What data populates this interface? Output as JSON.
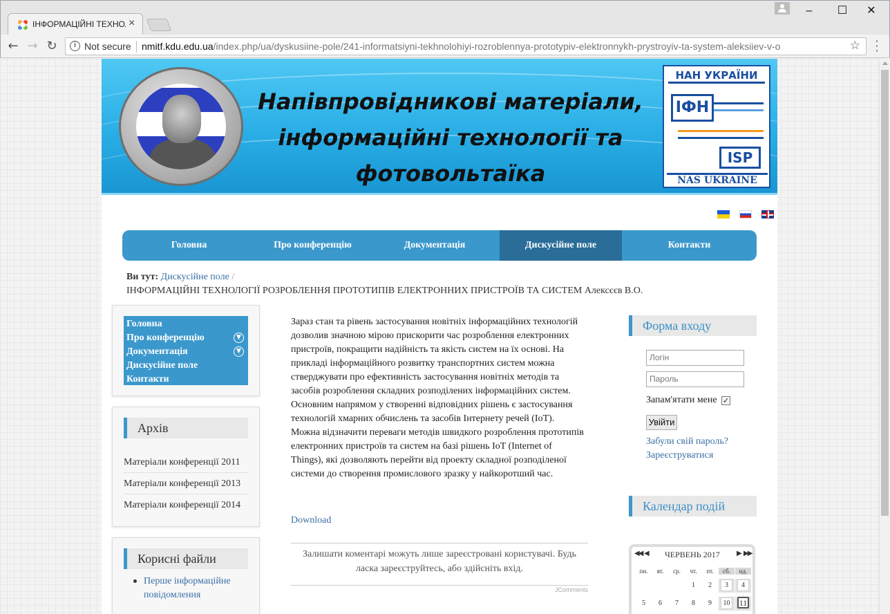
{
  "browser": {
    "tab_title": "ІНФОРМАЦІЙНІ ТЕХНОЛ",
    "tab_close": "×",
    "security_label": "Not secure",
    "url_host": "nmitf.kdu.edu.ua",
    "url_path": "/index.php/ua/dyskusiine-pole/241-informatsiyni-tekhnolohiyi-rozroblennya-prototypiv-elektronnykh-prystroyiv-ta-system-aleksiiev-v-o",
    "window_controls": [
      "–",
      "☐",
      "✕"
    ]
  },
  "banner": {
    "title_lines": [
      "Напівпровідникові матеріали,",
      "інформаційні технології та",
      "фотовольтаїка"
    ],
    "logo_top": "НАН УКРАЇНИ",
    "logo_ifn": "ІФН",
    "logo_isp": "ISP",
    "logo_bottom": "NAS UKRAINE"
  },
  "main_menu": [
    {
      "label": "Головна",
      "active": false
    },
    {
      "label": "Про конференцію",
      "active": false
    },
    {
      "label": "Документація",
      "active": false
    },
    {
      "label": "Дискусійне поле",
      "active": true
    },
    {
      "label": "Контакти",
      "active": false
    }
  ],
  "breadcrumb": {
    "here_label": "Ви тут:",
    "parent": "Дискусійне поле",
    "separator": "/",
    "current": "ІНФОРМАЦІЙНІ ТЕХНОЛОГІЇ РОЗРОБЛЕННЯ ПРОТОТИПІВ ЕЛЕКТРОННИХ ПРИСТРОЇВ ТА СИСТЕМ Алексєєв В.О."
  },
  "left_menu": [
    {
      "label": "Головна",
      "expandable": false
    },
    {
      "label": "Про конференцію",
      "expandable": true
    },
    {
      "label": "Документація",
      "expandable": true
    },
    {
      "label": "Дискусійне поле",
      "expandable": false
    },
    {
      "label": "Контакти",
      "expandable": false
    }
  ],
  "archive": {
    "title": "Архів",
    "items": [
      "Матеріали конференції 2011",
      "Матеріали конференції 2013",
      "Матеріали конференції 2014"
    ]
  },
  "useful_files": {
    "title": "Корисні файли",
    "items": [
      "Перше інформаційне повідомлення"
    ]
  },
  "article": {
    "text_lines": [
      "Зараз стан та рівень застосування новітніх інформаційних технологій",
      "дозволив значною мірою прискорити час розроблення електронних",
      "пристроїв, покращити надійність та якість систем на їх основі. На",
      "прикладі інформаційного розвитку транспортних систем можна",
      "стверджувати про ефективність застосування новітніх методів та",
      "засобів розроблення складних розподілених інформаційних систем.",
      "Основним напрямом у створенні відповідних рішень є застосування",
      "технологій хмарних обчислень та засобів Інтернету речей  (IoT).",
      "Можна відзначити переваги методів швидкого розроблення прототипів",
      "електронних пристроїв та систем на базі рішень IoT (Internet of",
      "Things), які дозволяють перейти від проекту складної розподіленої",
      "системи до створення промислового зразку у найкоротший час."
    ],
    "download_label": "Download",
    "comments_notice": "Залишати коментарі можуть лише зареєстровані користувачі. Будь ласка зареєструйтесь, або здійсніть вхід.",
    "comments_brand": "JComments"
  },
  "login": {
    "title": "Форма входу",
    "username_placeholder": "Логін",
    "password_placeholder": "Пароль",
    "remember_label": "Запам'ятати мене",
    "remember_checked": true,
    "submit_label": "Увійти",
    "forgot_label": "Забули свій пароль?",
    "register_label": "Зареєструватися"
  },
  "calendar": {
    "title": "Календар подій",
    "month_label": "ЧЕРВЕНЬ 2017",
    "weekdays": [
      "пн.",
      "вт.",
      "ср.",
      "чт.",
      "пт.",
      "сб.",
      "нд."
    ],
    "week1": [
      "",
      "",
      "",
      "1",
      "2",
      "3",
      "4"
    ],
    "week2": [
      "5",
      "6",
      "7",
      "8",
      "9",
      "10",
      "11"
    ],
    "today": "11"
  },
  "colors": {
    "menu_blue": "#3b98cc",
    "menu_active": "#2a6d98",
    "link": "#3a6fa6"
  }
}
